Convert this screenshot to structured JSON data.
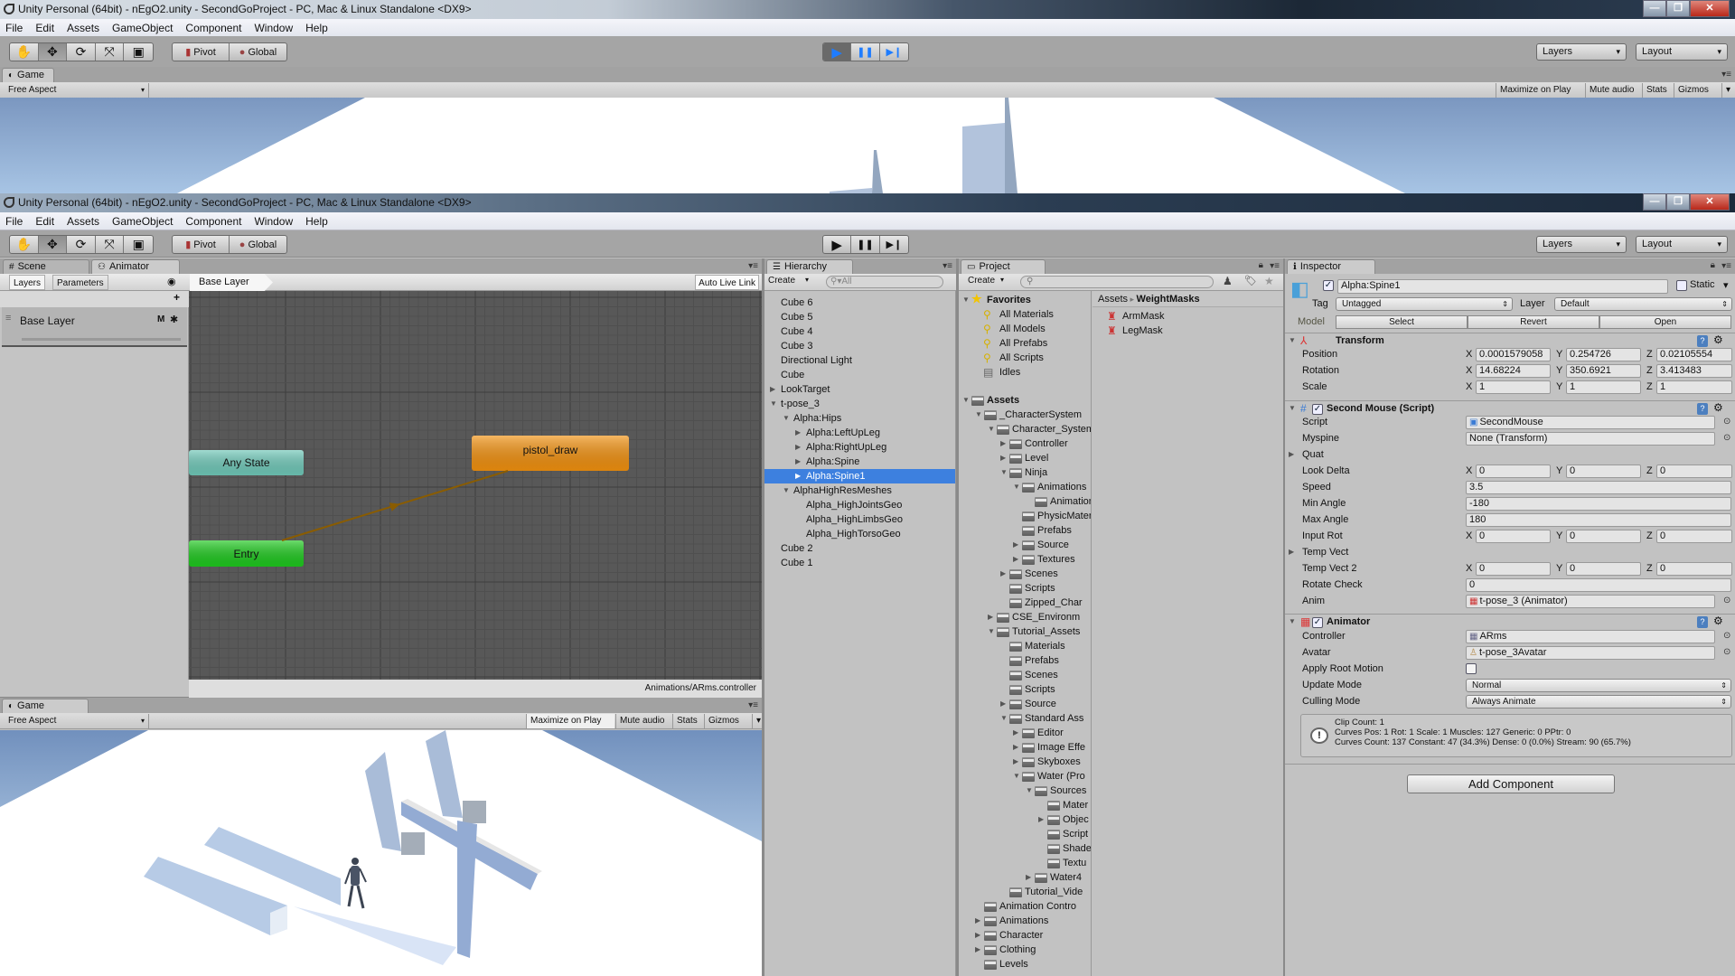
{
  "background_window": {
    "title": "Unity Personal (64bit) - nEgO2.unity - SecondGoProject - PC, Mac & Linux Standalone <DX9>",
    "menu": [
      "File",
      "Edit",
      "Assets",
      "GameObject",
      "Component",
      "Window",
      "Help"
    ],
    "toolbar": {
      "pivot": "Pivot",
      "global": "Global",
      "layers": "Layers",
      "layout": "Layout",
      "play_state": "playing"
    },
    "game": {
      "tab": "Game",
      "aspect": "Free Aspect",
      "buttons": [
        "Maximize on Play",
        "Mute audio",
        "Stats",
        "Gizmos"
      ],
      "maximize_on_play_active": false
    }
  },
  "window": {
    "title": "Unity Personal (64bit) - nEgO2.unity - SecondGoProject - PC, Mac & Linux Standalone <DX9>",
    "menu": [
      "File",
      "Edit",
      "Assets",
      "GameObject",
      "Component",
      "Window",
      "Help"
    ],
    "toolbar": {
      "pivot": "Pivot",
      "global": "Global",
      "layers": "Layers",
      "layout": "Layout",
      "play_state": "stopped"
    }
  },
  "animator": {
    "tabs": [
      "Scene",
      "Animator"
    ],
    "active_tab": "Animator",
    "subtabs": [
      "Layers",
      "Parameters"
    ],
    "add": "+",
    "layers": [
      {
        "name": "Base Layer",
        "badge": "M"
      }
    ],
    "breadcrumb": "Base Layer",
    "auto_live_link": "Auto Live Link",
    "states": [
      {
        "name": "Any State",
        "color": "#6fc8b8"
      },
      {
        "name": "Entry",
        "color": "#1ec81e"
      },
      {
        "name": "pistol_draw",
        "color": "#f0900f"
      }
    ],
    "transitions": [
      {
        "from": "Entry",
        "to": "pistol_draw"
      }
    ],
    "controller_path": "Animations/ARms.controller"
  },
  "game": {
    "tab": "Game",
    "aspect": "Free Aspect",
    "buttons": [
      "Maximize on Play",
      "Mute audio",
      "Stats",
      "Gizmos"
    ],
    "maximize_on_play_active": true
  },
  "hierarchy": {
    "tab": "Hierarchy",
    "create": "Create",
    "search_placeholder": "All",
    "items": [
      {
        "label": "Cube 6",
        "depth": 0
      },
      {
        "label": "Cube 5",
        "depth": 0
      },
      {
        "label": "Cube 4",
        "depth": 0
      },
      {
        "label": "Cube 3",
        "depth": 0
      },
      {
        "label": "Directional Light",
        "depth": 0
      },
      {
        "label": "Cube",
        "depth": 0
      },
      {
        "label": "LookTarget",
        "depth": 0,
        "arrow": "right"
      },
      {
        "label": "t-pose_3",
        "depth": 0,
        "arrow": "down"
      },
      {
        "label": "Alpha:Hips",
        "depth": 1,
        "arrow": "down"
      },
      {
        "label": "Alpha:LeftUpLeg",
        "depth": 2,
        "arrow": "right"
      },
      {
        "label": "Alpha:RightUpLeg",
        "depth": 2,
        "arrow": "right"
      },
      {
        "label": "Alpha:Spine",
        "depth": 2,
        "arrow": "right"
      },
      {
        "label": "Alpha:Spine1",
        "depth": 2,
        "arrow": "right",
        "selected": true
      },
      {
        "label": "AlphaHighResMeshes",
        "depth": 1,
        "arrow": "down"
      },
      {
        "label": "Alpha_HighJointsGeo",
        "depth": 2
      },
      {
        "label": "Alpha_HighLimbsGeo",
        "depth": 2
      },
      {
        "label": "Alpha_HighTorsoGeo",
        "depth": 2
      },
      {
        "label": "Cube 2",
        "depth": 0
      },
      {
        "label": "Cube 1",
        "depth": 0
      }
    ]
  },
  "project": {
    "tab": "Project",
    "create": "Create",
    "favorites": {
      "label": "Favorites",
      "items": [
        "All Materials",
        "All Models",
        "All Prefabs",
        "All Scripts",
        "Idles"
      ]
    },
    "assets_label": "Assets",
    "tree": [
      {
        "label": "_CharacterSystem",
        "depth": 1,
        "arrow": "down"
      },
      {
        "label": "Character_System",
        "depth": 2,
        "arrow": "down"
      },
      {
        "label": "Controller",
        "depth": 3,
        "arrow": "right"
      },
      {
        "label": "Level",
        "depth": 3,
        "arrow": "right"
      },
      {
        "label": "Ninja",
        "depth": 3,
        "arrow": "down"
      },
      {
        "label": "Animations",
        "depth": 4,
        "arrow": "down"
      },
      {
        "label": "Animations",
        "depth": 5
      },
      {
        "label": "PhysicMaterials",
        "depth": 4
      },
      {
        "label": "Prefabs",
        "depth": 4
      },
      {
        "label": "Source",
        "depth": 4,
        "arrow": "right"
      },
      {
        "label": "Textures",
        "depth": 4,
        "arrow": "right"
      },
      {
        "label": "Scenes",
        "depth": 3,
        "arrow": "right"
      },
      {
        "label": "Scripts",
        "depth": 3
      },
      {
        "label": "Zipped_Char",
        "depth": 3
      },
      {
        "label": "CSE_Environm",
        "depth": 2,
        "arrow": "right"
      },
      {
        "label": "Tutorial_Assets",
        "depth": 2,
        "arrow": "down"
      },
      {
        "label": "Materials",
        "depth": 3
      },
      {
        "label": "Prefabs",
        "depth": 3
      },
      {
        "label": "Scenes",
        "depth": 3
      },
      {
        "label": "Scripts",
        "depth": 3
      },
      {
        "label": "Source",
        "depth": 3,
        "arrow": "right"
      },
      {
        "label": "Standard Ass",
        "depth": 3,
        "arrow": "down"
      },
      {
        "label": "Editor",
        "depth": 4,
        "arrow": "right"
      },
      {
        "label": "Image Effe",
        "depth": 4,
        "arrow": "right"
      },
      {
        "label": "Skyboxes",
        "depth": 4,
        "arrow": "right"
      },
      {
        "label": "Water (Pro",
        "depth": 4,
        "arrow": "down"
      },
      {
        "label": "Sources",
        "depth": 5,
        "arrow": "down"
      },
      {
        "label": "Mater",
        "depth": 6
      },
      {
        "label": "Objec",
        "depth": 6,
        "arrow": "right"
      },
      {
        "label": "Script",
        "depth": 6
      },
      {
        "label": "Shade",
        "depth": 6
      },
      {
        "label": "Textu",
        "depth": 6
      },
      {
        "label": "Water4",
        "depth": 5,
        "arrow": "right"
      },
      {
        "label": "Tutorial_Vide",
        "depth": 3
      },
      {
        "label": "Animation Contro",
        "depth": 1
      },
      {
        "label": "Animations",
        "depth": 1,
        "arrow": "right"
      },
      {
        "label": "Character",
        "depth": 1,
        "arrow": "right"
      },
      {
        "label": "Clothing",
        "depth": 1,
        "arrow": "right"
      },
      {
        "label": "Levels",
        "depth": 1
      }
    ],
    "breadcrumb": [
      "Assets",
      "WeightMasks"
    ],
    "files": [
      "ArmMask",
      "LegMask"
    ]
  },
  "inspector": {
    "tab": "Inspector",
    "object_name": "Alpha:Spine1",
    "active": true,
    "static_label": "Static",
    "static": false,
    "tag_label": "Tag",
    "tag": "Untagged",
    "layer_label": "Layer",
    "layer": "Default",
    "model_label": "Model",
    "model_buttons": [
      "Select",
      "Revert",
      "Open"
    ],
    "components": [
      {
        "title": "Transform",
        "icon": "transform-icon",
        "rows": [
          {
            "type": "vec3",
            "label": "Position",
            "x": "0.0001579058",
            "y": "0.254726",
            "z": "0.02105554"
          },
          {
            "type": "vec3",
            "label": "Rotation",
            "x": "14.68224",
            "y": "350.6921",
            "z": "3.413483"
          },
          {
            "type": "vec3",
            "label": "Scale",
            "x": "1",
            "y": "1",
            "z": "1"
          }
        ]
      },
      {
        "title": "Second Mouse (Script)",
        "icon": "script-icon",
        "enabled": true,
        "rows": [
          {
            "type": "object",
            "label": "Script",
            "value": "SecondMouse"
          },
          {
            "type": "object",
            "label": "Myspine",
            "value": "None (Transform)"
          },
          {
            "type": "foldout",
            "label": "Quat"
          },
          {
            "type": "vec3",
            "label": "Look Delta",
            "x": "0",
            "y": "0",
            "z": "0"
          },
          {
            "type": "field",
            "label": "Speed",
            "value": "3.5"
          },
          {
            "type": "field",
            "label": "Min Angle",
            "value": "-180"
          },
          {
            "type": "field",
            "label": "Max Angle",
            "value": "180"
          },
          {
            "type": "vec3",
            "label": "Input Rot",
            "x": "0",
            "y": "0",
            "z": "0"
          },
          {
            "type": "foldout",
            "label": "Temp Vect"
          },
          {
            "type": "vec3",
            "label": "Temp Vect 2",
            "x": "0",
            "y": "0",
            "z": "0"
          },
          {
            "type": "field",
            "label": "Rotate Check",
            "value": "0"
          },
          {
            "type": "object",
            "label": "Anim",
            "value": "t-pose_3 (Animator)"
          }
        ]
      },
      {
        "title": "Animator",
        "icon": "animator-icon",
        "enabled": true,
        "rows": [
          {
            "type": "object",
            "label": "Controller",
            "value": "ARms"
          },
          {
            "type": "object",
            "label": "Avatar",
            "value": "t-pose_3Avatar"
          },
          {
            "type": "checkbox",
            "label": "Apply Root Motion",
            "checked": false
          },
          {
            "type": "dropdown",
            "label": "Update Mode",
            "value": "Normal"
          },
          {
            "type": "dropdown",
            "label": "Culling Mode",
            "value": "Always Animate"
          }
        ]
      }
    ],
    "info": [
      "Clip Count: 1",
      "Curves Pos: 1 Rot: 1 Scale: 1 Muscles: 127 Generic: 0 PPtr: 0",
      "Curves Count: 137 Constant: 47 (34.3%) Dense: 0 (0.0%) Stream: 90 (65.7%)"
    ],
    "add_component": "Add Component"
  },
  "colors": {
    "selection": "#3d80df",
    "panel": "#c2c2c2",
    "toolbar": "#a5a5a5",
    "grid": "#585858"
  }
}
